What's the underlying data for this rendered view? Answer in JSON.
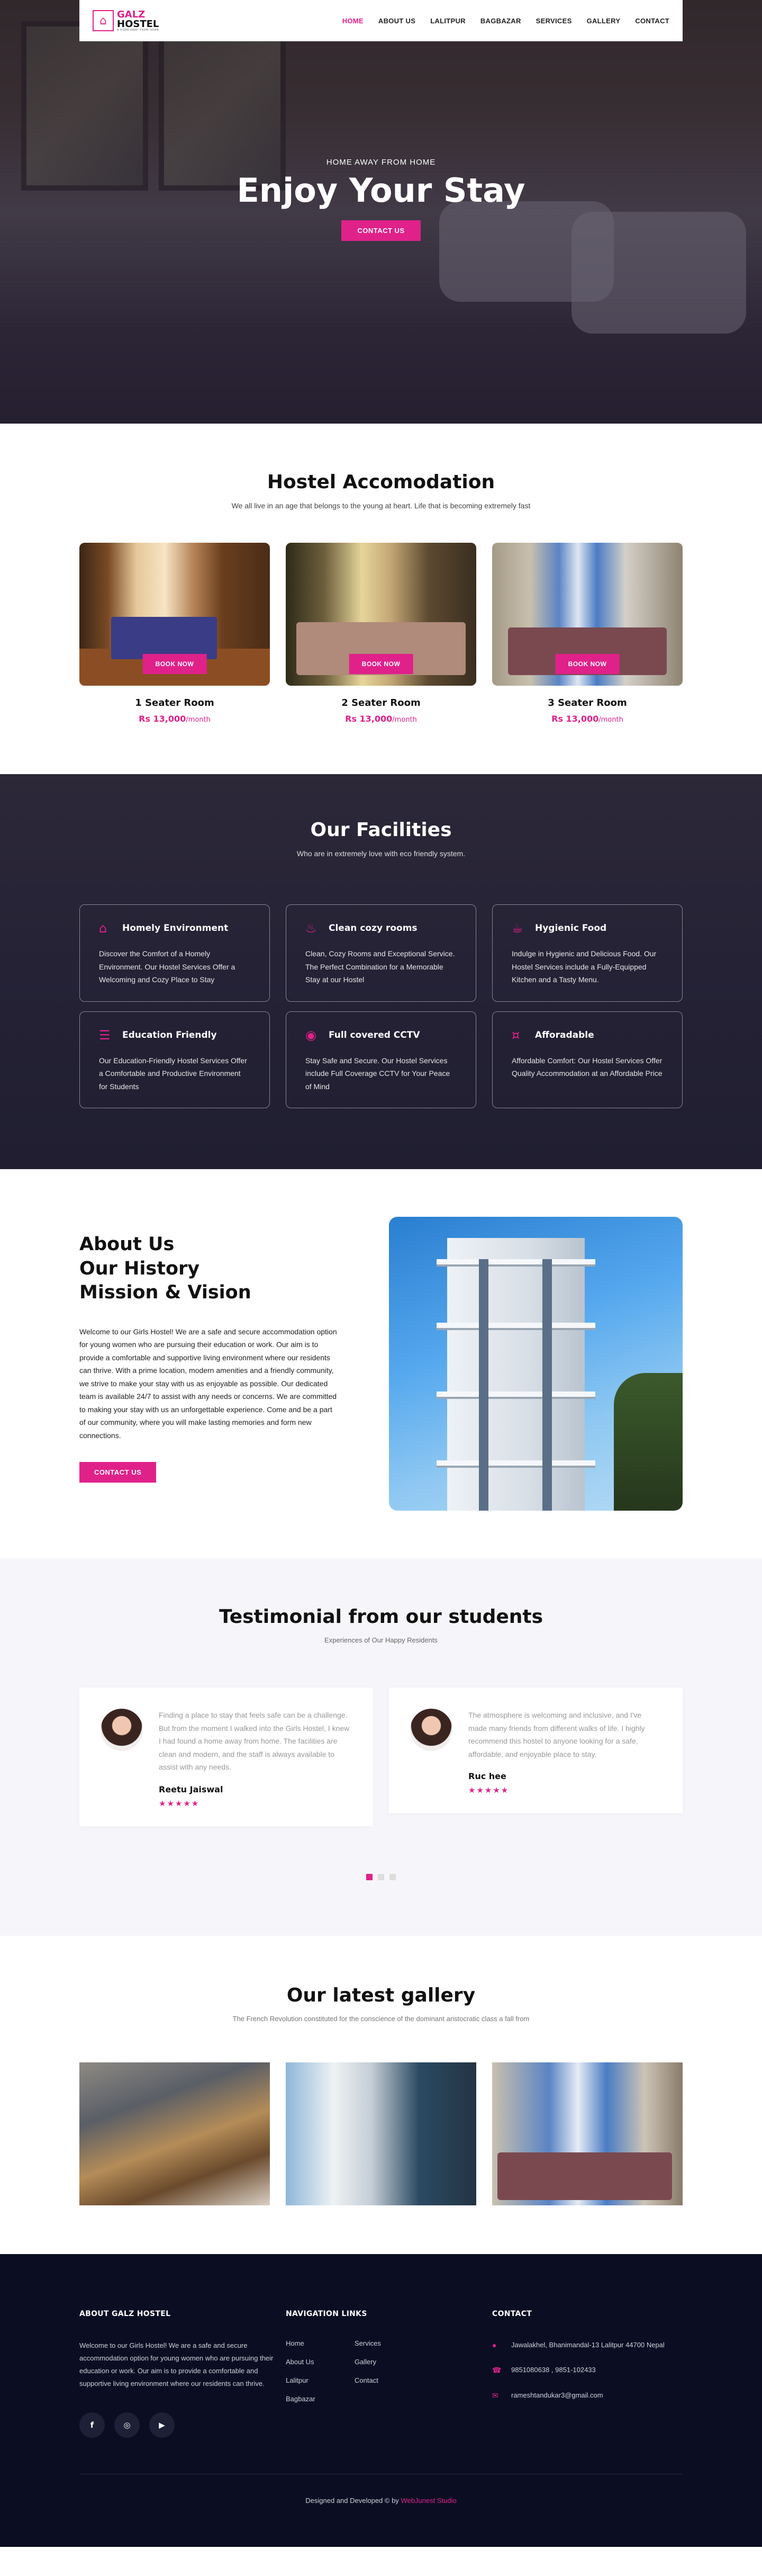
{
  "brand": {
    "name_top": "GALZ",
    "name_bottom": "HOSTEL",
    "tagline": "A HOME AWAY FROM HOME",
    "accent": "#e0218a"
  },
  "nav": {
    "items": [
      {
        "label": "HOME",
        "active": true
      },
      {
        "label": "ABOUT US"
      },
      {
        "label": "LALITPUR"
      },
      {
        "label": "BAGBAZAR"
      },
      {
        "label": "SERVICES"
      },
      {
        "label": "GALLERY"
      },
      {
        "label": "CONTACT"
      }
    ]
  },
  "hero": {
    "subtitle": "HOME AWAY FROM HOME",
    "title": "Enjoy Your Stay",
    "cta": "CONTACT US"
  },
  "accomodation": {
    "title": "Hostel Accomodation",
    "subtitle": "We all live in an age that belongs to the young at heart. Life that is becoming extremely fast",
    "rooms": [
      {
        "name": "1 Seater Room",
        "price": "Rs 13,000",
        "unit": "/month",
        "cta": "BOOK NOW"
      },
      {
        "name": "2 Seater Room",
        "price": "Rs 13,000",
        "unit": "/month",
        "cta": "BOOK NOW"
      },
      {
        "name": "3 Seater Room",
        "price": "Rs 13,000",
        "unit": "/month",
        "cta": "BOOK NOW"
      }
    ]
  },
  "facilities": {
    "title": "Our Facilities",
    "subtitle": "Who are in extremely love with eco friendly system.",
    "items": [
      {
        "icon": "home-icon",
        "title": "Homely Environment",
        "text": "Discover the Comfort of a Homely Environment. Our Hostel Services Offer a Welcoming and Cozy Place to Stay"
      },
      {
        "icon": "bed-icon",
        "title": "Clean cozy rooms",
        "text": "Clean, Cozy Rooms and Exceptional Service. The Perfect Combination for a Memorable Stay at our Hostel"
      },
      {
        "icon": "food-icon",
        "title": "Hygienic Food",
        "text": "Indulge in Hygienic and Delicious Food. Our Hostel Services include a Fully-Equipped Kitchen and a Tasty Menu."
      },
      {
        "icon": "book-icon",
        "title": "Education Friendly",
        "text": "Our Education-Friendly Hostel Services Offer a Comfortable and Productive Environment for Students"
      },
      {
        "icon": "cctv-icon",
        "title": "Full covered CCTV",
        "text": "Stay Safe and Secure. Our Hostel Services include Full Coverage CCTV for Your Peace of Mind"
      },
      {
        "icon": "money-icon",
        "title": "Afforadable",
        "text": "Affordable Comfort: Our Hostel Services Offer Quality Accommodation at an Affordable Price"
      }
    ]
  },
  "about": {
    "title_lines": [
      "About Us",
      "Our History",
      "Mission & Vision"
    ],
    "text": "Welcome to our Girls Hostel! We are a safe and secure accommodation option for young women who are pursuing their education or work. Our aim is to provide a comfortable and supportive living environment where our residents can thrive. With a prime location, modern amenities and a friendly community, we strive to make your stay with us as enjoyable as possible. Our dedicated team is available 24/7 to assist with any needs or concerns. We are committed to making your stay with us an unforgettable experience. Come and be a part of our community, where you will make lasting memories and form new connections.",
    "cta": "CONTACT US"
  },
  "testimonials": {
    "title": "Testimonial from our students",
    "subtitle": "Experiences of Our Happy Residents",
    "items": [
      {
        "quote": "Finding a place to stay that feels safe can be a challenge. But from the moment I walked into the Girls Hostel, I knew I had found a home away from home. The facilities are clean and modern, and the staff is always available to assist with any needs.",
        "name": "Reetu Jaiswal",
        "stars": "★★★★★"
      },
      {
        "quote": "The atmosphere is welcoming and inclusive, and I've made many friends from different walks of life. I highly recommend this hostel to anyone looking for a safe, affordable, and enjoyable place to stay.",
        "name": "Ruc hee",
        "stars": "★★★★★"
      }
    ]
  },
  "gallery": {
    "title": "Our latest gallery",
    "subtitle": "The French Revolution constituted for the conscience of the dominant aristocratic class a fall from"
  },
  "footer": {
    "about_title": "ABOUT GALZ HOSTEL",
    "about_text": "Welcome to our Girls Hostel! We are a safe and secure accommodation option for young women who are pursuing their education or work. Our aim is to provide a comfortable and supportive living environment where our residents can thrive.",
    "socials": [
      "f",
      "◎",
      "▶"
    ],
    "nav_title": "NAVIGATION LINKS",
    "nav_links": [
      "Home",
      "Services",
      "About Us",
      "Gallery",
      "Lalitpur",
      "Contact",
      "Bagbazar"
    ],
    "contact_title": "CONTACT",
    "address": "Jawalakhel, Bhanimandal-13 Lalitpur 44700 Nepal",
    "phone": "9851080638 , 9851-102433",
    "email": "rameshtandukar3@gmail.com",
    "credit_prefix": "Designed and Developed © by",
    "credit_link": "WebJunest Studio"
  }
}
